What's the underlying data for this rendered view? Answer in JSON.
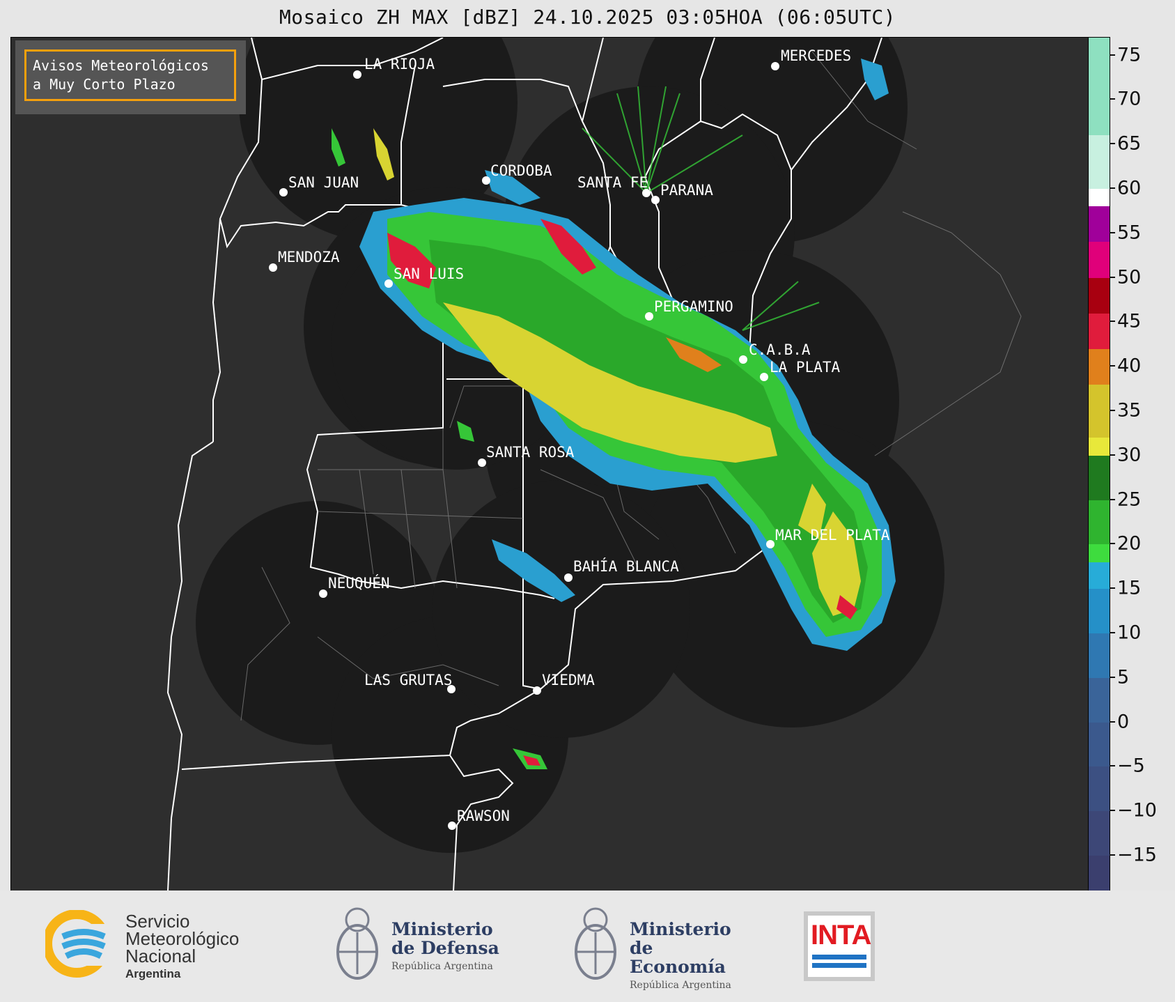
{
  "title": "Mosaico ZH MAX [dBZ] 24.10.2025 03:05HOA (06:05UTC)",
  "badge": {
    "line1": "Avisos Meteorológicos",
    "line2": "a Muy Corto Plazo",
    "border_color": "#f5a00d"
  },
  "cities": [
    "LA RIOJA",
    "MERCEDES",
    "CORDOBA",
    "SAN JUAN",
    "SANTA FE",
    "PARANA",
    "MENDOZA",
    "SAN LUIS",
    "PERGAMINO",
    "C.A.B.A",
    "LA PLATA",
    "SANTA ROSA",
    "MAR DEL PLATA",
    "BAHÍA BLANCA",
    "NEUQUÉN",
    "LAS GRUTAS",
    "VIEDMA",
    "RAWSON"
  ],
  "colorbar": {
    "unit": "dBZ",
    "min": -19,
    "max": 77,
    "ticks": [
      "75",
      "70",
      "65",
      "60",
      "55",
      "50",
      "45",
      "40",
      "35",
      "30",
      "25",
      "20",
      "15",
      "10",
      "5",
      "0",
      "−5",
      "−10",
      "−15"
    ],
    "tick_values": [
      75,
      70,
      65,
      60,
      55,
      50,
      45,
      40,
      35,
      30,
      25,
      20,
      15,
      10,
      5,
      0,
      -5,
      -10,
      -15
    ],
    "bands": [
      {
        "from": -19,
        "to": -15,
        "color": "#3b3f6e"
      },
      {
        "from": -15,
        "to": -10,
        "color": "#3d4777"
      },
      {
        "from": -10,
        "to": -5,
        "color": "#3c5082"
      },
      {
        "from": -5,
        "to": 0,
        "color": "#3b598d"
      },
      {
        "from": 0,
        "to": 5,
        "color": "#3a6499"
      },
      {
        "from": 5,
        "to": 10,
        "color": "#2f78b2"
      },
      {
        "from": 10,
        "to": 15,
        "color": "#2590c8"
      },
      {
        "from": 15,
        "to": 18,
        "color": "#27acd8"
      },
      {
        "from": 18,
        "to": 20,
        "color": "#3edc3e"
      },
      {
        "from": 20,
        "to": 25,
        "color": "#2fb42f"
      },
      {
        "from": 25,
        "to": 30,
        "color": "#1f7a1f"
      },
      {
        "from": 30,
        "to": 32,
        "color": "#e8e83a"
      },
      {
        "from": 32,
        "to": 38,
        "color": "#d4c42c"
      },
      {
        "from": 38,
        "to": 42,
        "color": "#e0801c"
      },
      {
        "from": 42,
        "to": 46,
        "color": "#e01c3c"
      },
      {
        "from": 46,
        "to": 50,
        "color": "#a80010"
      },
      {
        "from": 50,
        "to": 54,
        "color": "#e0007a"
      },
      {
        "from": 54,
        "to": 58,
        "color": "#a0009a"
      },
      {
        "from": 58,
        "to": 60,
        "color": "#ffffff"
      },
      {
        "from": 60,
        "to": 66,
        "color": "#c8f0e0"
      },
      {
        "from": 66,
        "to": 77,
        "color": "#8ee0c0"
      }
    ]
  },
  "footer": {
    "smn": [
      "Servicio",
      "Meteorológico",
      "Nacional",
      "Argentina"
    ],
    "defensa": [
      "Ministerio",
      "de Defensa",
      "República Argentina"
    ],
    "economia": [
      "Ministerio",
      "de Economía",
      "República Argentina"
    ],
    "inta": "INTA"
  }
}
